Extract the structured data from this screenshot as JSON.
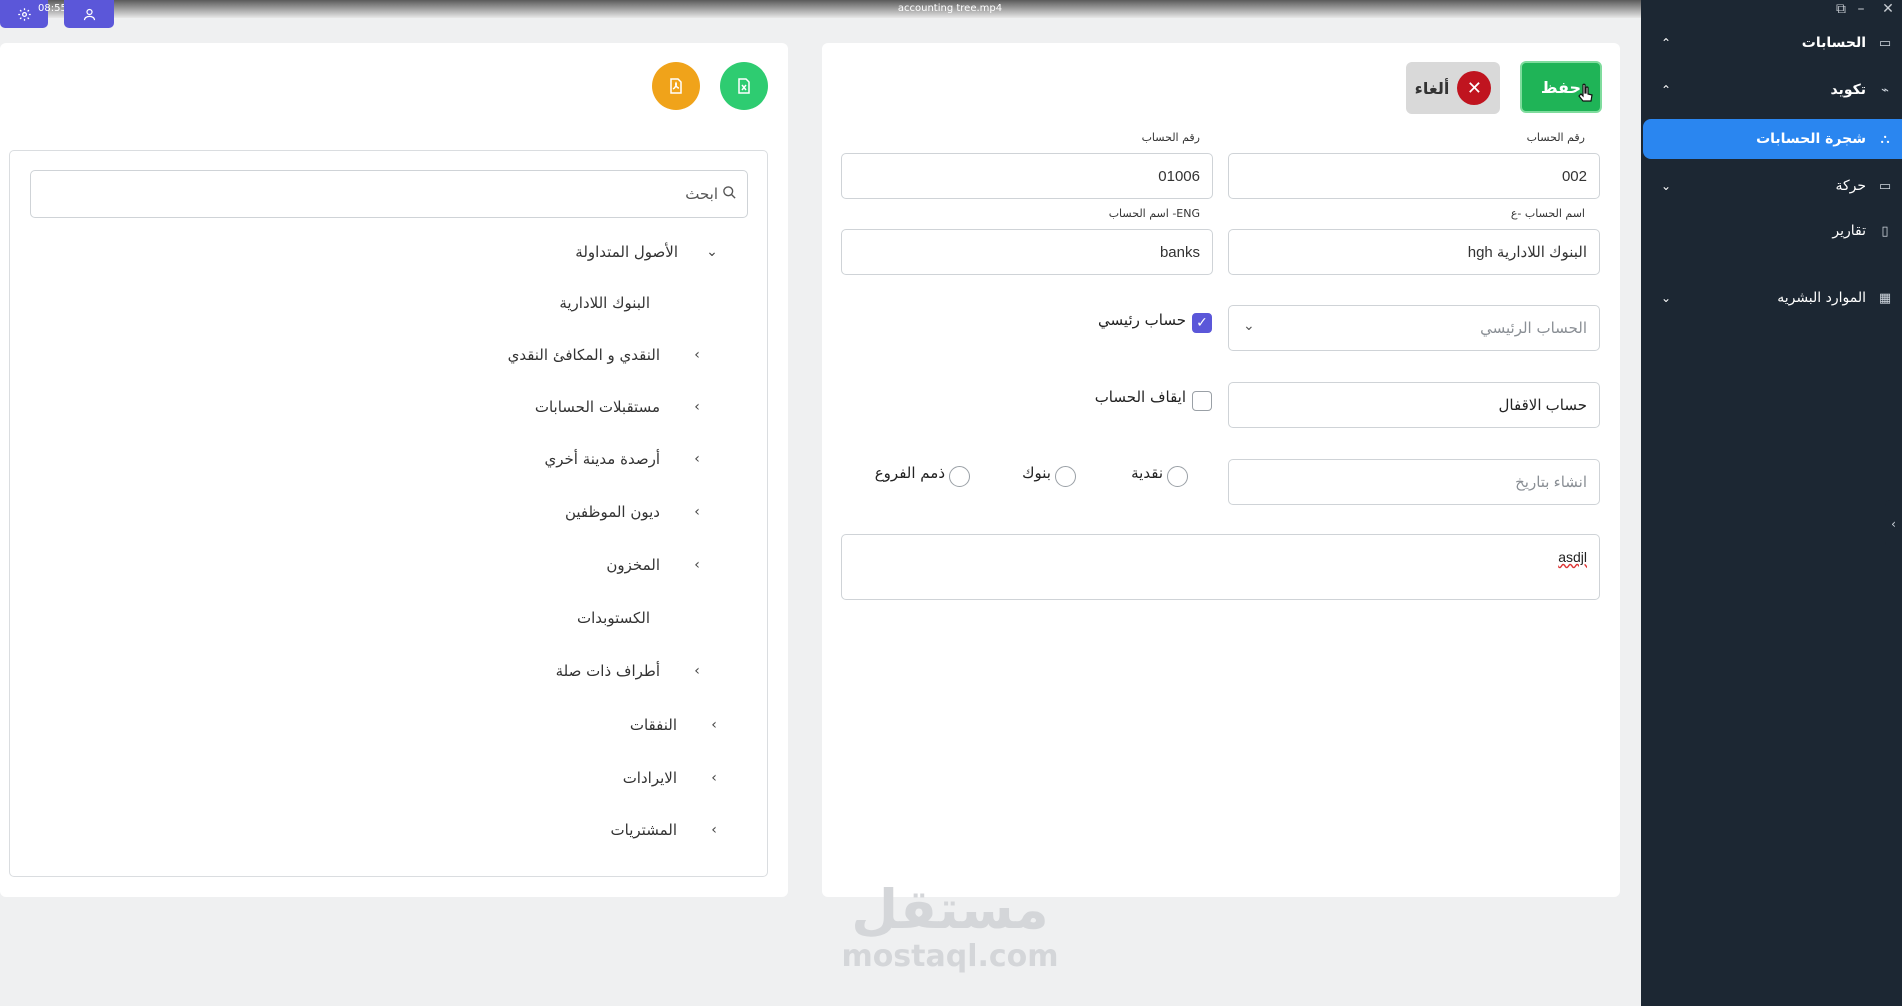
{
  "window": {
    "title": "accounting tree.mp4",
    "clock": "08:55"
  },
  "sidebar": {
    "items": [
      {
        "label": "الحسابات",
        "icon": "monitor-icon",
        "chevron": "up"
      },
      {
        "label": "تكويد",
        "icon": "chart-icon",
        "chevron": "up"
      },
      {
        "label": "شجرة الحسابات",
        "icon": "tree-icon",
        "active": true
      },
      {
        "label": "حركة",
        "icon": "screen-icon",
        "chevron": "down"
      },
      {
        "label": "تقارير",
        "icon": "document-icon"
      },
      {
        "label": "الموارد البشريه",
        "icon": "grid-icon",
        "chevron": "down"
      }
    ]
  },
  "form": {
    "save_label": "حفظ",
    "cancel_label": "ألغاء",
    "account_no_label": "رقم الحساب",
    "account_no_value": "002",
    "account_no2_label": "رقم الحساب",
    "account_no2_value": "01006",
    "name_ar_label": "اسم الحساب -ع",
    "name_ar_value": "البنوك اللادارية hgh",
    "name_en_label": "اسم الحساب -ENG",
    "name_en_value": "banks",
    "main_account_placeholder": "الحساب الرئيسي",
    "main_account_check_label": "حساب رئيسي",
    "main_account_checked": true,
    "closing_account_value": "حساب الاقفال",
    "stop_account_label": "ايقاف الحساب",
    "stop_account_checked": false,
    "created_at_placeholder": "انشاء بتاريخ",
    "radio_cash": "نقدية",
    "radio_banks": "بنوك",
    "radio_branches": "ذمم الفروع",
    "notes_value": "asdjl"
  },
  "tree": {
    "search_placeholder": "ابحث",
    "nodes": [
      {
        "label": "الأصول المتداولة",
        "level": 0,
        "expanded": true
      },
      {
        "label": "البنوك اللادارية",
        "level": 1,
        "leaf": true
      },
      {
        "label": "النقدي و المكافئ النقدي",
        "level": 1
      },
      {
        "label": "مستقبلات الحسابات",
        "level": 1
      },
      {
        "label": "أرصدة مدينة أخري",
        "level": 1
      },
      {
        "label": "ديون الموظفين",
        "level": 1
      },
      {
        "label": "المخزون",
        "level": 1
      },
      {
        "label": "الكستوبدات",
        "level": 1,
        "leaf": true
      },
      {
        "label": "أطراف ذات صلة",
        "level": 1
      },
      {
        "label": "النفقات",
        "level": 0
      },
      {
        "label": "الايرادات",
        "level": 0
      },
      {
        "label": "المشتريات",
        "level": 0
      }
    ]
  },
  "watermark": {
    "ar": "مستقل",
    "en": "mostaql.com"
  },
  "colors": {
    "sidebar": "#1c2733",
    "active": "#2a86f0",
    "save": "#1fb457",
    "cancel_x": "#c0141f",
    "accent": "#5b57d9",
    "excel": "#2ecc71",
    "pdf": "#f0a31a"
  }
}
